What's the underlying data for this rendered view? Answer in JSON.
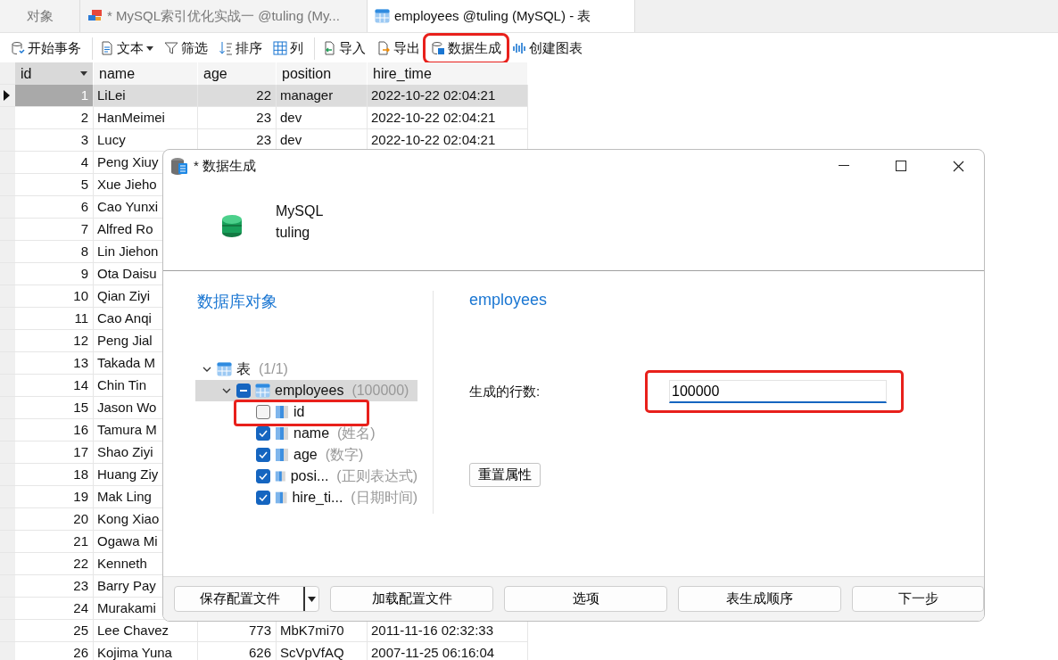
{
  "tabs": [
    {
      "label": "对象",
      "selected": false,
      "kind": "plain"
    },
    {
      "label": "* MySQL索引优化实战一 @tuling (My...",
      "selected": false,
      "kind": "query"
    },
    {
      "label": "employees @tuling (MySQL) - 表",
      "selected": true,
      "kind": "table"
    }
  ],
  "toolbar": [
    [
      {
        "label": "开始事务",
        "kind": "transaction",
        "dropdown": false,
        "highlighted": false
      }
    ],
    [
      {
        "label": "文本",
        "kind": "text",
        "dropdown": true,
        "highlighted": false
      },
      {
        "label": "筛选",
        "kind": "filter",
        "dropdown": false,
        "highlighted": false
      },
      {
        "label": "排序",
        "kind": "sort",
        "dropdown": false,
        "highlighted": false
      },
      {
        "label": "列",
        "kind": "columns",
        "dropdown": false,
        "highlighted": false
      }
    ],
    [
      {
        "label": "导入",
        "kind": "import",
        "dropdown": false,
        "highlighted": false
      },
      {
        "label": "导出",
        "kind": "export",
        "dropdown": false,
        "highlighted": false
      },
      {
        "label": "数据生成",
        "kind": "generate",
        "dropdown": false,
        "highlighted": true
      },
      {
        "label": "创建图表",
        "kind": "chart",
        "dropdown": false,
        "highlighted": false
      }
    ]
  ],
  "grid": {
    "columns": [
      {
        "label": "id",
        "selected": true
      },
      {
        "label": "name",
        "selected": false
      },
      {
        "label": "age",
        "selected": false
      },
      {
        "label": "position",
        "selected": false
      },
      {
        "label": "hire_time",
        "selected": false
      }
    ],
    "rows": [
      {
        "cells": [
          "1",
          "LiLei",
          "22",
          "manager",
          "2022-10-22 02:04:21"
        ],
        "selected": true
      },
      {
        "cells": [
          "2",
          "HanMeimei",
          "23",
          "dev",
          "2022-10-22 02:04:21"
        ],
        "selected": false
      },
      {
        "cells": [
          "3",
          "Lucy",
          "23",
          "dev",
          "2022-10-22 02:04:21"
        ],
        "selected": false
      },
      {
        "cells": [
          "4",
          "Peng Xiuy"
        ],
        "selected": false
      },
      {
        "cells": [
          "5",
          "Xue Jieho"
        ],
        "selected": false
      },
      {
        "cells": [
          "6",
          "Cao Yunxi"
        ],
        "selected": false
      },
      {
        "cells": [
          "7",
          "Alfred Ro"
        ],
        "selected": false
      },
      {
        "cells": [
          "8",
          "Lin Jiehon"
        ],
        "selected": false
      },
      {
        "cells": [
          "9",
          "Ota Daisu"
        ],
        "selected": false
      },
      {
        "cells": [
          "10",
          "Qian Ziyi"
        ],
        "selected": false
      },
      {
        "cells": [
          "11",
          "Cao Anqi"
        ],
        "selected": false
      },
      {
        "cells": [
          "12",
          "Peng Jial"
        ],
        "selected": false
      },
      {
        "cells": [
          "13",
          "Takada M"
        ],
        "selected": false
      },
      {
        "cells": [
          "14",
          "Chin Tin"
        ],
        "selected": false
      },
      {
        "cells": [
          "15",
          "Jason Wo"
        ],
        "selected": false
      },
      {
        "cells": [
          "16",
          "Tamura M"
        ],
        "selected": false
      },
      {
        "cells": [
          "17",
          "Shao Ziyi"
        ],
        "selected": false
      },
      {
        "cells": [
          "18",
          "Huang Ziy"
        ],
        "selected": false
      },
      {
        "cells": [
          "19",
          "Mak Ling"
        ],
        "selected": false
      },
      {
        "cells": [
          "20",
          "Kong Xiao"
        ],
        "selected": false
      },
      {
        "cells": [
          "21",
          "Ogawa Mi"
        ],
        "selected": false
      },
      {
        "cells": [
          "22",
          "Kenneth"
        ],
        "selected": false
      },
      {
        "cells": [
          "23",
          "Barry Pay"
        ],
        "selected": false
      },
      {
        "cells": [
          "24",
          "Murakami"
        ],
        "selected": false
      },
      {
        "cells": [
          "25",
          "Lee Chavez",
          "773",
          "MbK7mi70",
          "2011-11-16 02:32:33"
        ],
        "selected": false
      },
      {
        "cells": [
          "26",
          "Kojima Yuna",
          "626",
          "ScVpVfAQ",
          "2007-11-25 06:16:04"
        ],
        "selected": false
      }
    ]
  },
  "dialog": {
    "title": "* 数据生成",
    "connection": {
      "type": "MySQL",
      "database": "tuling"
    },
    "objects_heading": "数据库对象",
    "tree": [
      {
        "label": "表",
        "count": "(1/1)",
        "expanded": true,
        "children": [
          {
            "label": "employees",
            "count": "(100000)",
            "expanded": true,
            "mixed": true,
            "selected": true,
            "children": [
              {
                "label": "id",
                "checked": false,
                "highlighted": true
              },
              {
                "label": "name",
                "hint": "(姓名)",
                "checked": true,
                "highlighted": false
              },
              {
                "label": "age",
                "hint": "(数字)",
                "checked": true,
                "highlighted": false
              },
              {
                "label": "posi...",
                "hint": "(正则表达式)",
                "checked": true,
                "highlighted": false
              },
              {
                "label": "hire_ti...",
                "hint": "(日期时间)",
                "checked": true,
                "highlighted": false
              }
            ]
          }
        ]
      }
    ],
    "table_name": "employees",
    "rows_label": "生成的行数:",
    "rows_value": "100000",
    "rows_highlighted": true,
    "reset_button": "重置属性",
    "footer_buttons": [
      {
        "label": "保存配置文件",
        "kind": "split"
      },
      {
        "label": "加载配置文件",
        "kind": "plain"
      },
      {
        "label": "选项",
        "kind": "plain"
      },
      {
        "label": "表生成顺序",
        "kind": "plain"
      },
      {
        "label": "下一步",
        "kind": "plain"
      }
    ]
  }
}
